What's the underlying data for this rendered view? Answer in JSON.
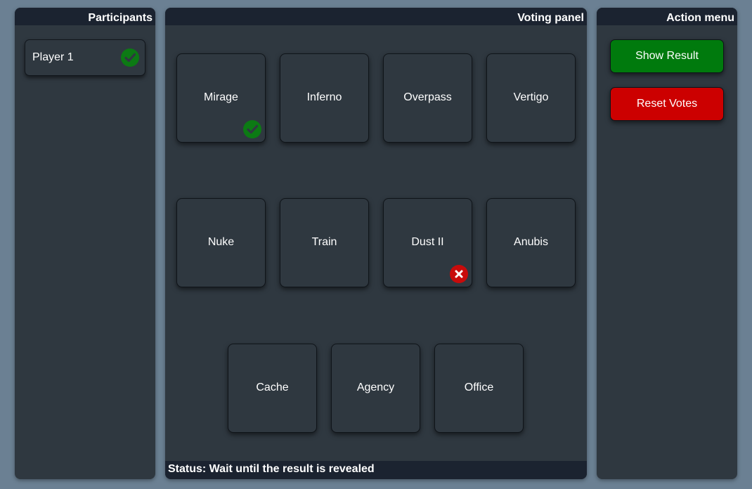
{
  "participants": {
    "title": "Participants",
    "players": [
      {
        "name": "Player 1",
        "status_icon": "check-icon"
      }
    ]
  },
  "voting": {
    "title": "Voting panel",
    "maps": [
      {
        "name": "Mirage",
        "mark": "check-icon"
      },
      {
        "name": "Inferno",
        "mark": null
      },
      {
        "name": "Overpass",
        "mark": null
      },
      {
        "name": "Vertigo",
        "mark": null
      },
      {
        "name": "Nuke",
        "mark": null
      },
      {
        "name": "Train",
        "mark": null
      },
      {
        "name": "Dust II",
        "mark": "x-icon"
      },
      {
        "name": "Anubis",
        "mark": null
      },
      {
        "name": "Cache",
        "mark": null
      },
      {
        "name": "Agency",
        "mark": null
      },
      {
        "name": "Office",
        "mark": null
      }
    ],
    "status": "Status: Wait until the result is revealed"
  },
  "actions": {
    "title": "Action menu",
    "show_result_label": "Show Result",
    "reset_votes_label": "Reset Votes"
  },
  "colors": {
    "background": "#6b8093",
    "panel": "#2f3840",
    "header": "#1b2330",
    "check_green": "#0c7a14",
    "cross_red": "#c80b0b",
    "show_button": "#007a0d",
    "reset_button": "#cc0000"
  }
}
